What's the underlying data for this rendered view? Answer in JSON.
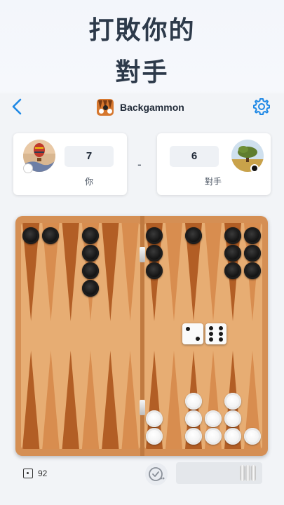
{
  "promo": {
    "line1": "打敗你的",
    "line2": "對手"
  },
  "header": {
    "title": "Backgammon",
    "back_icon": "chevron-left-icon",
    "settings_icon": "gear-icon",
    "accent": "#1e88e5"
  },
  "players": {
    "me": {
      "score": "7",
      "name": "你",
      "avatar": "hot-air-balloon",
      "checker_color": "white"
    },
    "separator": "-",
    "opponent": {
      "score": "6",
      "name": "對手",
      "avatar": "tree-landscape",
      "checker_color": "black"
    }
  },
  "board": {
    "colors": {
      "frame": "#d58f54",
      "field": "#e7ad73",
      "point_dark": "#b25e25",
      "point_light": "#d88d4f"
    },
    "top_points": [
      {
        "point": 1,
        "color": "black",
        "count": 1
      },
      {
        "point": 2,
        "color": "black",
        "count": 1
      },
      {
        "point": 3,
        "color": "",
        "count": 0
      },
      {
        "point": 4,
        "color": "black",
        "count": 4
      },
      {
        "point": 5,
        "color": "",
        "count": 0
      },
      {
        "point": 6,
        "color": "",
        "count": 0
      },
      {
        "point": 7,
        "color": "black",
        "count": 3
      },
      {
        "point": 8,
        "color": "",
        "count": 0
      },
      {
        "point": 9,
        "color": "black",
        "count": 1
      },
      {
        "point": 10,
        "color": "",
        "count": 0
      },
      {
        "point": 11,
        "color": "black",
        "count": 3
      },
      {
        "point": 12,
        "color": "black",
        "count": 3
      }
    ],
    "bottom_points": [
      {
        "point": 1,
        "color": "",
        "count": 0
      },
      {
        "point": 2,
        "color": "",
        "count": 0
      },
      {
        "point": 3,
        "color": "",
        "count": 0
      },
      {
        "point": 4,
        "color": "",
        "count": 0
      },
      {
        "point": 5,
        "color": "",
        "count": 0
      },
      {
        "point": 6,
        "color": "",
        "count": 0
      },
      {
        "point": 7,
        "color": "white",
        "count": 2
      },
      {
        "point": 8,
        "color": "",
        "count": 0
      },
      {
        "point": 9,
        "color": "white",
        "count": 3
      },
      {
        "point": 10,
        "color": "white",
        "count": 2
      },
      {
        "point": 11,
        "color": "white",
        "count": 3
      },
      {
        "point": 12,
        "color": "white",
        "count": 1
      }
    ],
    "dice": [
      2,
      6
    ]
  },
  "footer": {
    "pip_icon": "die-one-icon",
    "pip_count": "92",
    "auto_icon": "auto-play-icon",
    "borne_off_white": 0
  }
}
